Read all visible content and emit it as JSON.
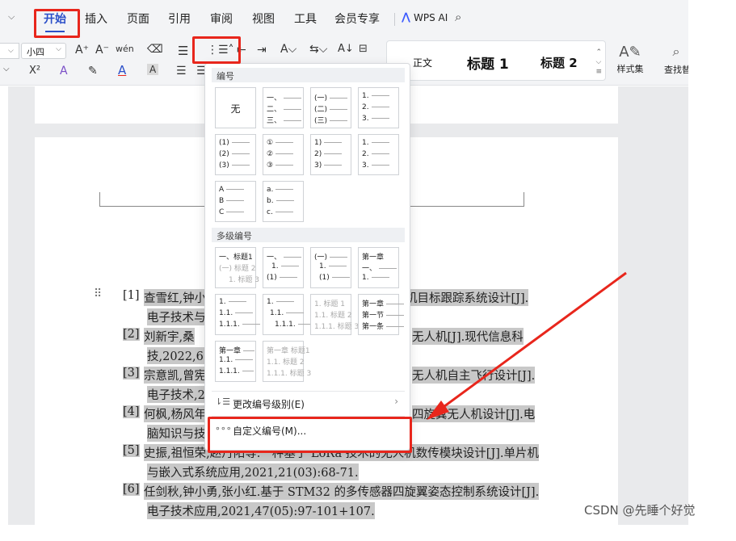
{
  "menu": {
    "collapse_icon": "chevron-down-icon",
    "tabs": [
      "开始",
      "插入",
      "页面",
      "引用",
      "审阅",
      "视图",
      "工具",
      "会员专享"
    ],
    "active_tab": "开始",
    "wps_ai_label": "WPS AI",
    "search_icon": "search-icon"
  },
  "ribbon": {
    "font_size_value": "小四",
    "grow_font": "A⁺",
    "shrink_font": "A⁻",
    "phonetic": "wén",
    "clear_format": "⌫",
    "superscript": "X²",
    "text_effect": "A",
    "highlight": "✎",
    "font_color": "A",
    "char_shading": "A",
    "styles": {
      "normal": "正文",
      "heading1": "标题 1",
      "heading2": "标题 2"
    },
    "style_set_label": "样式集",
    "find_label": "查找替换"
  },
  "dropdown": {
    "numbering_header": "编号",
    "none_label": "无",
    "numbering_cells": [
      {
        "rows": [
          "一、",
          "二、",
          "三、"
        ]
      },
      {
        "rows": [
          "(一)",
          "(二)",
          "(三)"
        ]
      },
      {
        "rows": [
          "1.",
          "2.",
          "3."
        ]
      },
      {
        "rows": [
          "(1)",
          "(2)",
          "(3)"
        ]
      },
      {
        "rows": [
          "①",
          "②",
          "③"
        ]
      },
      {
        "rows": [
          "1)",
          "2)",
          "3)"
        ]
      },
      {
        "rows": [
          "1.",
          "2.",
          "3."
        ]
      },
      {
        "rows": [
          "A",
          "B",
          "C"
        ]
      },
      {
        "rows": [
          "a.",
          "b.",
          "c."
        ]
      }
    ],
    "multilevel_header": "多级编号",
    "multilevel_cells": [
      {
        "rows": [
          "一、标题1",
          "(一) 标题 2",
          "1. 标题 3"
        ]
      },
      {
        "rows": [
          "一、",
          "1.",
          "(1)"
        ]
      },
      {
        "rows": [
          "(一)",
          "1.",
          "(1)"
        ]
      },
      {
        "rows": [
          "第一章",
          "一、",
          "1."
        ]
      },
      {
        "rows": [
          "1.",
          "1.1.",
          "1.1.1."
        ]
      },
      {
        "rows": [
          "1.",
          "1.1.",
          "1.1.1."
        ]
      },
      {
        "rows": [
          "1. 标题 1",
          "1.1. 标题 2",
          "1.1.1. 标题 3"
        ]
      },
      {
        "rows": [
          "第一章",
          "第一节",
          "第一条"
        ]
      },
      {
        "rows": [
          "第一章",
          "1.1.",
          "1.1.1."
        ]
      },
      {
        "rows": [
          "第一章 标题1",
          "1.1. 标题 2",
          "1.1.1. 标题 3"
        ]
      }
    ],
    "change_level_label": "更改编号级别(E)",
    "custom_numbering_label": "自定义编号(M)..."
  },
  "references": [
    {
      "num": "[1]",
      "line1": "查雪红,钟小",
      "tail1": "机目标跟踪系统设计[J].",
      "line2": "电子技术与"
    },
    {
      "num": "[2]",
      "line1": "刘新宇,桑",
      "tail1": "无人机[J].现代信息科",
      "line2": "技,2022,6(2"
    },
    {
      "num": "[3]",
      "line1": "宗意凯,曾宪",
      "tail1": "无人机自主飞行设计[J].",
      "line2": "电子技术,20"
    },
    {
      "num": "[4]",
      "line1": "何枫,杨风年",
      "tail1": "四旋翼无人机设计[J].电",
      "line2": "脑知识与技"
    },
    {
      "num": "[5]",
      "line1": "史振,祖恒荣,赵丹阳等.一种基于 LoRa 技术的无人机数传模块设计[J].单片机",
      "tail1": "",
      "line2": "与嵌入式系统应用,2021,21(03):68-71."
    },
    {
      "num": "[6]",
      "line1": "任剑秋,钟小勇,张小红.基于 STM32 的多传感器四旋翼姿态控制系统设计[J].",
      "tail1": "",
      "line2": "电子技术应用,2021,47(05):97-101+107."
    }
  ],
  "watermark": "CSDN @先睡个好觉",
  "colors": {
    "accent": "#2b4fc8",
    "annotation_red": "#e8261c",
    "highlight_gray": "#c8c8c8"
  }
}
